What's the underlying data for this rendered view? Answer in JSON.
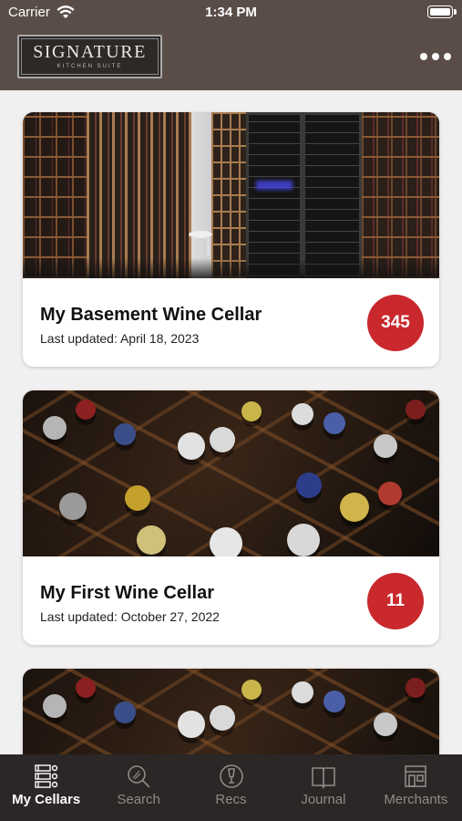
{
  "status_bar": {
    "carrier": "Carrier",
    "time": "1:34 PM"
  },
  "header": {
    "logo_brand": "SIGNATURE",
    "logo_sub": "KITCHEN SUITE",
    "more_icon": "more-horizontal-icon"
  },
  "cellars": [
    {
      "name": "My Basement Wine Cellar",
      "updated": "Last updated: April 18, 2023",
      "count": "345",
      "photo": "cellar-racks"
    },
    {
      "name": "My First Wine Cellar",
      "updated": "Last updated: October 27, 2022",
      "count": "11",
      "photo": "bottle-tops"
    },
    {
      "name": "",
      "updated": "",
      "count": "",
      "photo": "bottle-tops"
    }
  ],
  "tabbar": {
    "tabs": [
      {
        "label": "My Cellars",
        "icon": "cellars-icon",
        "active": true
      },
      {
        "label": "Search",
        "icon": "search-icon",
        "active": false
      },
      {
        "label": "Recs",
        "icon": "recs-icon",
        "active": false
      },
      {
        "label": "Journal",
        "icon": "journal-icon",
        "active": false
      },
      {
        "label": "Merchants",
        "icon": "merchants-icon",
        "active": false
      }
    ]
  },
  "colors": {
    "header_bg": "#5a4d47",
    "badge": "#c9282d",
    "tabbar_bg": "#2b2726",
    "tab_inactive": "#8f8b89",
    "tab_active": "#ffffff"
  }
}
